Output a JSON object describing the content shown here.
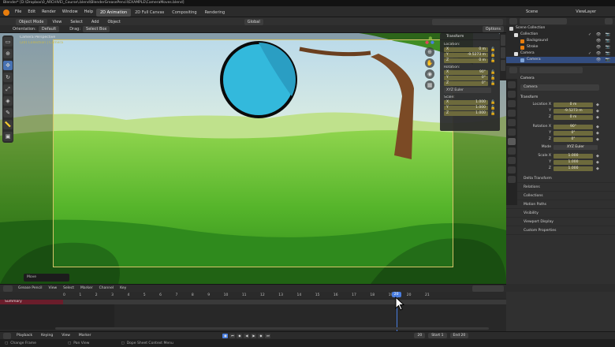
{
  "title_bar": "Blender* [D:\\Dropbox\\0_ARCHIVE\\_Course\\.blend\\BlenderGreasePencil\\EXAMPLE\\CameraMoves.blend]",
  "menu": [
    "File",
    "Edit",
    "Render",
    "Window",
    "Help"
  ],
  "workspaces": [
    "2D Animation",
    "2D Full Canvas",
    "Compositing",
    "Rendering"
  ],
  "active_workspace": "2D Animation",
  "scene_label": "Scene",
  "view_layer_label": "ViewLayer",
  "header": {
    "mode": "Object Mode",
    "view": "View",
    "select": "Select",
    "add": "Add",
    "object": "Object",
    "orientation_label": "Orientation:",
    "orientation": "Default",
    "drag_label": "Drag:",
    "drag": "Select Box",
    "transform_orientation": "Global",
    "options": "Options"
  },
  "viewport": {
    "camera_label": "Camera Perspective",
    "camera_name": "(20) Collection | Camera",
    "snap_popup": "Move"
  },
  "tools": [
    "select-box-icon",
    "cursor-icon",
    "move-icon",
    "rotate-icon",
    "scale-icon",
    "transform-icon",
    "annotate-icon",
    "measure-icon",
    "add-cube-icon"
  ],
  "npanel": {
    "title": "Transform",
    "location_label": "Location:",
    "location": [
      {
        "axis": "X",
        "value": "0 m"
      },
      {
        "axis": "Y",
        "value": "-9.5273 m"
      },
      {
        "axis": "Z",
        "value": "0 m"
      }
    ],
    "rotation_label": "Rotation:",
    "rotation": [
      {
        "axis": "X",
        "value": "90°"
      },
      {
        "axis": "Y",
        "value": "0°"
      },
      {
        "axis": "Z",
        "value": "0°"
      }
    ],
    "rotation_mode": "XYZ Euler",
    "scale_label": "Scale:",
    "scale": [
      {
        "axis": "X",
        "value": "1.000"
      },
      {
        "axis": "Y",
        "value": "1.000"
      },
      {
        "axis": "Z",
        "value": "1.000"
      }
    ]
  },
  "outliner": {
    "title": "Scene Collection",
    "rows": [
      {
        "label": "Scene Collection",
        "indent": 0,
        "selected": false,
        "icon_color": "#cfcfcf"
      },
      {
        "label": "Collection",
        "indent": 1,
        "selected": false,
        "icon_color": "#e0e0e0"
      },
      {
        "label": "Background",
        "indent": 2,
        "selected": false,
        "icon_color": "#e87d0d"
      },
      {
        "label": "Stroke",
        "indent": 2,
        "selected": false,
        "icon_color": "#e87d0d"
      },
      {
        "label": "Camera",
        "indent": 1,
        "selected": false,
        "icon_color": "#e0e0e0"
      },
      {
        "label": "Camera",
        "indent": 2,
        "selected": true,
        "icon_color": "#7fa4d8"
      }
    ]
  },
  "properties": {
    "object_name": "Camera",
    "object_field": "Camera",
    "transform_title": "Transform",
    "location": [
      {
        "key": "Location X",
        "value": "0 m"
      },
      {
        "key": "Y",
        "value": "-9.5273 m"
      },
      {
        "key": "Z",
        "value": "0 m"
      }
    ],
    "rotation": [
      {
        "key": "Rotation X",
        "value": "90°"
      },
      {
        "key": "Y",
        "value": "0°"
      },
      {
        "key": "Z",
        "value": "0°"
      }
    ],
    "mode_label": "Mode",
    "mode": "XYZ Euler",
    "scale": [
      {
        "key": "Scale X",
        "value": "1.000"
      },
      {
        "key": "Y",
        "value": "1.000"
      },
      {
        "key": "Z",
        "value": "1.000"
      }
    ],
    "delta_transform": "Delta Transform",
    "sections": [
      "Relations",
      "Collections",
      "Motion Paths",
      "Visibility",
      "Viewport Display",
      "Custom Properties"
    ]
  },
  "timeline": {
    "editor": "Grease Pencil",
    "menus": [
      "View",
      "Select",
      "Marker",
      "Channel",
      "Key"
    ],
    "summary": "Summary",
    "frames": [
      "0",
      "1",
      "2",
      "3",
      "4",
      "5",
      "6",
      "7",
      "8",
      "9",
      "10",
      "11",
      "12",
      "13",
      "14",
      "15",
      "16",
      "17",
      "18",
      "19",
      "20",
      "21"
    ],
    "current_frame": "20",
    "current_frame_fraction": 0.909,
    "footer_menus": [
      "Playback",
      "Keying",
      "View",
      "Marker"
    ],
    "frame_field": "20",
    "start_label": "Start",
    "start": "1",
    "end_label": "End",
    "end": "20"
  },
  "statusbar": {
    "left": "Change Frame",
    "mid": "Pan View",
    "right": "Dope Sheet Context Menu"
  },
  "colors": {
    "accent": "#4772b3",
    "keyframe_field": "#6d6a3c",
    "summary_row": "#6b1d2b",
    "camera_frame": "#d7c56a",
    "ball_fill": "#33b9dc"
  }
}
